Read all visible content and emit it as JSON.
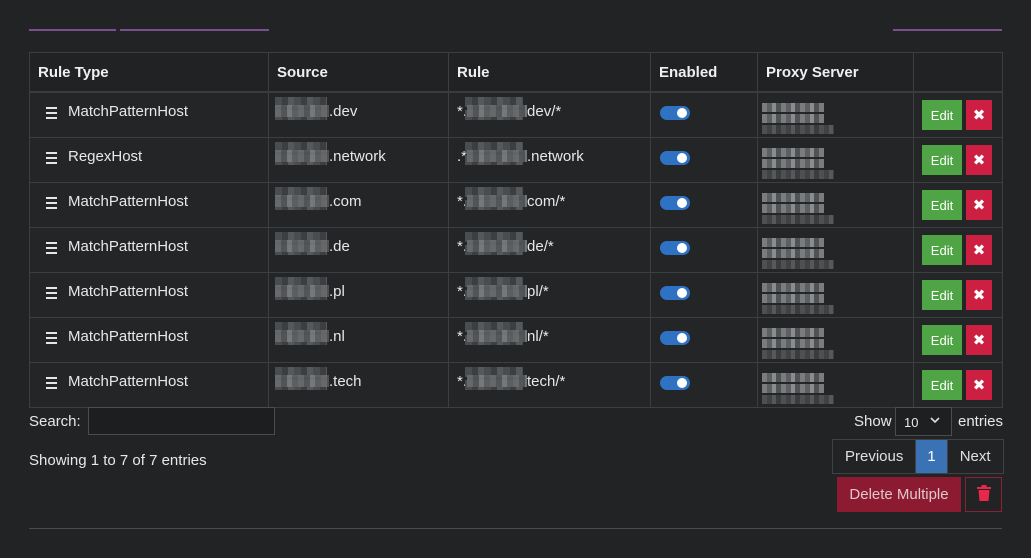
{
  "table": {
    "columns": [
      "Rule Type",
      "Source",
      "Rule",
      "Enabled",
      "Proxy Server",
      ""
    ],
    "rows": [
      {
        "rule_type": "MatchPatternHost",
        "source_suffix": ".dev",
        "rule_prefix": "*.",
        "rule_suffix": "dev/*",
        "enabled": true
      },
      {
        "rule_type": "RegexHost",
        "source_suffix": ".network",
        "rule_prefix": ".*",
        "rule_suffix": ".network",
        "enabled": true
      },
      {
        "rule_type": "MatchPatternHost",
        "source_suffix": ".com",
        "rule_prefix": "*.",
        "rule_suffix": "com/*",
        "enabled": true
      },
      {
        "rule_type": "MatchPatternHost",
        "source_suffix": ".de",
        "rule_prefix": "*.",
        "rule_suffix": "de/*",
        "enabled": true
      },
      {
        "rule_type": "MatchPatternHost",
        "source_suffix": ".pl",
        "rule_prefix": "*.",
        "rule_suffix": "pl/*",
        "enabled": true
      },
      {
        "rule_type": "MatchPatternHost",
        "source_suffix": ".nl",
        "rule_prefix": "*.",
        "rule_suffix": "nl/*",
        "enabled": true
      },
      {
        "rule_type": "MatchPatternHost",
        "source_suffix": ".tech",
        "rule_prefix": "*.",
        "rule_suffix": "tech/*",
        "enabled": true
      }
    ],
    "edit_label": "Edit",
    "delete_glyph": "✖"
  },
  "search": {
    "label": "Search:",
    "value": ""
  },
  "length": {
    "show_label": "Show",
    "selected": "10",
    "entries_label": "entries",
    "chevron": "❯"
  },
  "info": "Showing 1 to 7 of 7 entries",
  "pagination": {
    "previous": "Previous",
    "current": "1",
    "next": "Next"
  },
  "delete_multiple_label": "Delete Multiple",
  "colors": {
    "accent": "#7b4f8c",
    "toggle": "#2f72c4",
    "edit": "#4fa446",
    "delete": "#cc1f42"
  },
  "icons": {
    "drag": "drag-handle-icon",
    "delete": "close-icon",
    "trash": "trash-icon",
    "chevron": "chevron-down-icon"
  }
}
